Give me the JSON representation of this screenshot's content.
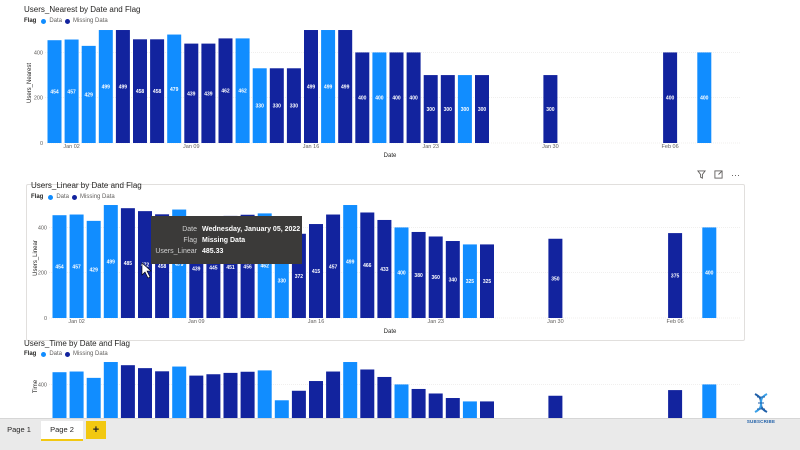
{
  "colors": {
    "data": "#118DFF",
    "missing": "#12239E",
    "axis_text": "#605e5c",
    "gridline": "#e1dfdd"
  },
  "visuals": [
    {
      "title": "Users_Nearest by Date and Flag",
      "legend": {
        "label": "Flag",
        "items": [
          "Data",
          "Missing Data"
        ]
      },
      "ylabel": "Users_Nearest",
      "xlabel": "Date",
      "yticks": [
        0,
        200,
        400
      ],
      "xticks": [
        "Jan 02",
        "Jan 09",
        "Jan 16",
        "Jan 23",
        "Jan 30",
        "Feb 06"
      ]
    },
    {
      "title": "Users_Linear by Date and Flag",
      "legend": {
        "label": "Flag",
        "items": [
          "Data",
          "Missing Data"
        ]
      },
      "ylabel": "Users_Linear",
      "xlabel": "Date",
      "yticks": [
        0,
        200,
        400
      ],
      "xticks": [
        "Jan 02",
        "Jan 09",
        "Jan 16",
        "Jan 23",
        "Jan 30",
        "Feb 06"
      ]
    },
    {
      "title": "Users_Time by Date and Flag",
      "legend": {
        "label": "Flag",
        "items": [
          "Data",
          "Missing Data"
        ]
      },
      "ylabel": "Time",
      "yticks": [
        400
      ]
    }
  ],
  "chart_data": [
    {
      "type": "bar",
      "title": "Users_Nearest by Date and Flag",
      "xlabel": "Date",
      "ylabel": "Users_Nearest",
      "ylim": [
        0,
        530
      ],
      "legend": "top-left",
      "categories": [
        "Jan 01",
        "Jan 02",
        "Jan 03",
        "Jan 04",
        "Jan 05",
        "Jan 06",
        "Jan 07",
        "Jan 08",
        "Jan 09",
        "Jan 10",
        "Jan 11",
        "Jan 12",
        "Jan 13",
        "Jan 14",
        "Jan 15",
        "Jan 16",
        "Jan 17",
        "Jan 18",
        "Jan 19",
        "Jan 20",
        "Jan 21",
        "Jan 22",
        "Jan 23",
        "Jan 24",
        "Jan 25",
        "Jan 26",
        "Jan 30",
        "Feb 06",
        "Feb 08"
      ],
      "values": [
        454,
        457,
        429,
        499,
        499,
        458,
        458,
        479,
        439,
        439,
        462,
        462,
        330,
        330,
        330,
        499,
        499,
        499,
        400,
        400,
        400,
        400,
        300,
        300,
        300,
        300,
        300,
        400,
        400
      ],
      "flags": [
        "Data",
        "Data",
        "Data",
        "Data",
        "Missing Data",
        "Missing Data",
        "Missing Data",
        "Data",
        "Missing Data",
        "Missing Data",
        "Missing Data",
        "Data",
        "Data",
        "Missing Data",
        "Missing Data",
        "Missing Data",
        "Data",
        "Missing Data",
        "Missing Data",
        "Data",
        "Missing Data",
        "Missing Data",
        "Missing Data",
        "Missing Data",
        "Data",
        "Missing Data",
        "Missing Data",
        "Missing Data",
        "Data"
      ]
    },
    {
      "type": "bar",
      "title": "Users_Linear by Date and Flag",
      "xlabel": "Date",
      "ylabel": "Users_Linear",
      "ylim": [
        0,
        530
      ],
      "legend": "top-left",
      "categories": [
        "Jan 01",
        "Jan 02",
        "Jan 03",
        "Jan 04",
        "Jan 05",
        "Jan 06",
        "Jan 07",
        "Jan 08",
        "Jan 09",
        "Jan 10",
        "Jan 11",
        "Jan 12",
        "Jan 13",
        "Jan 14",
        "Jan 15",
        "Jan 16",
        "Jan 17",
        "Jan 18",
        "Jan 19",
        "Jan 20",
        "Jan 21",
        "Jan 22",
        "Jan 23",
        "Jan 24",
        "Jan 25",
        "Jan 26",
        "Jan 30",
        "Feb 06",
        "Feb 08"
      ],
      "values": [
        454,
        457,
        429,
        499,
        485,
        472,
        458,
        479,
        439,
        445,
        451,
        456,
        462,
        330,
        372,
        415,
        457,
        499,
        466,
        433,
        400,
        380,
        360,
        340,
        325,
        325,
        350,
        375,
        400
      ],
      "labels": [
        "454",
        "457",
        "429",
        "499",
        "485",
        "472",
        "458",
        "479",
        "439",
        "445",
        "451",
        "456",
        "462",
        "330",
        "372",
        "415",
        "457",
        "499",
        "466",
        "433",
        "400",
        "380",
        "360",
        "340",
        "325",
        "325",
        "350",
        "375",
        "400"
      ],
      "flags": [
        "Data",
        "Data",
        "Data",
        "Data",
        "Missing Data",
        "Missing Data",
        "Missing Data",
        "Data",
        "Missing Data",
        "Missing Data",
        "Missing Data",
        "Missing Data",
        "Data",
        "Data",
        "Missing Data",
        "Missing Data",
        "Missing Data",
        "Data",
        "Missing Data",
        "Missing Data",
        "Data",
        "Missing Data",
        "Missing Data",
        "Missing Data",
        "Data",
        "Missing Data",
        "Missing Data",
        "Missing Data",
        "Data"
      ],
      "tooltip": {
        "Date": "Wednesday, January 05, 2022",
        "Flag": "Missing Data",
        "Users_Linear": "485.33"
      }
    },
    {
      "type": "bar",
      "title": "Users_Time by Date and Flag",
      "ylabel": "Time",
      "ylim": [
        0,
        530
      ],
      "legend": "top-left",
      "categories": [
        "Jan 01",
        "Jan 02",
        "Jan 03",
        "Jan 04",
        "Jan 05",
        "Jan 06",
        "Jan 07",
        "Jan 08",
        "Jan 09",
        "Jan 10",
        "Jan 11",
        "Jan 12",
        "Jan 13",
        "Jan 14",
        "Jan 15",
        "Jan 16",
        "Jan 17",
        "Jan 18",
        "Jan 19",
        "Jan 20",
        "Jan 21",
        "Jan 22",
        "Jan 23",
        "Jan 24",
        "Jan 25",
        "Jan 26",
        "Jan 30",
        "Feb 06",
        "Feb 08"
      ],
      "values": [
        454,
        457,
        429,
        499,
        485,
        472,
        458,
        479,
        439,
        445,
        451,
        456,
        462,
        330,
        372,
        415,
        457,
        499,
        466,
        433,
        400,
        380,
        360,
        340,
        325,
        325,
        350,
        375,
        400
      ],
      "flags": [
        "Data",
        "Data",
        "Data",
        "Data",
        "Missing Data",
        "Missing Data",
        "Missing Data",
        "Data",
        "Missing Data",
        "Missing Data",
        "Missing Data",
        "Missing Data",
        "Data",
        "Data",
        "Missing Data",
        "Missing Data",
        "Missing Data",
        "Data",
        "Missing Data",
        "Missing Data",
        "Data",
        "Missing Data",
        "Missing Data",
        "Missing Data",
        "Data",
        "Missing Data",
        "Missing Data",
        "Missing Data",
        "Data"
      ]
    }
  ],
  "tooltip": {
    "keys": [
      "Date",
      "Flag",
      "Users_Linear"
    ],
    "values": [
      "Wednesday, January 05, 2022",
      "Missing Data",
      "485.33"
    ]
  },
  "tabs": {
    "page1": "Page 1",
    "page2": "Page 2",
    "add": "+"
  },
  "subscribe": {
    "label": "SUBSCRIBE",
    "icon": "dna-icon"
  },
  "header_icons": [
    "filter-icon",
    "focus-mode-icon",
    "more-options-icon"
  ]
}
